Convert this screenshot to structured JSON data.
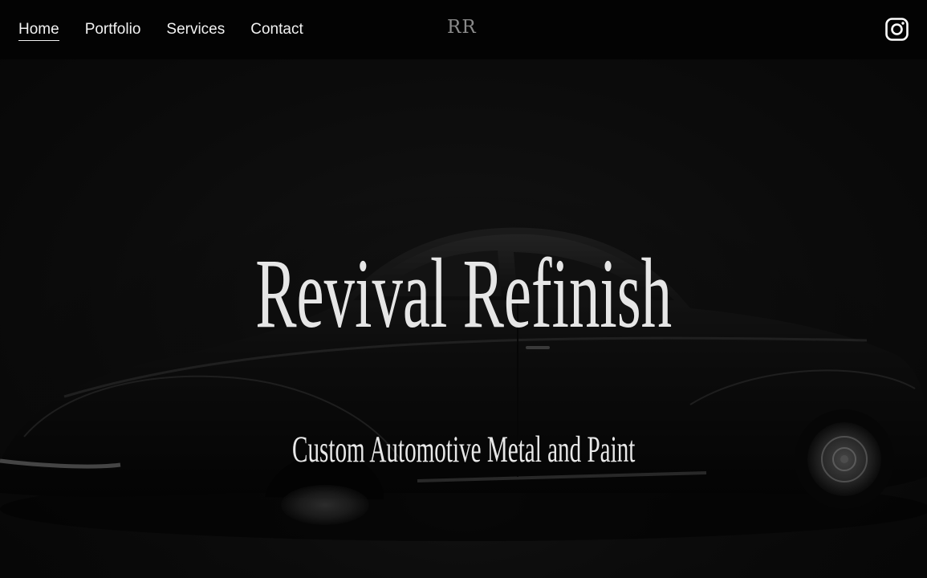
{
  "nav": {
    "items": [
      {
        "label": "Home",
        "active": true
      },
      {
        "label": "Portfolio",
        "active": false
      },
      {
        "label": "Services",
        "active": false
      },
      {
        "label": "Contact",
        "active": false
      }
    ]
  },
  "logo": {
    "text": "RR"
  },
  "social": {
    "icon": "instagram-icon"
  },
  "hero": {
    "title": "Revival Refinish",
    "subtitle": "Custom Automotive Metal and Paint"
  },
  "colors": {
    "header_bg": "#030303",
    "hero_bg": "#121212",
    "text": "#e6e6e6",
    "logo": "#8a8a8a"
  }
}
